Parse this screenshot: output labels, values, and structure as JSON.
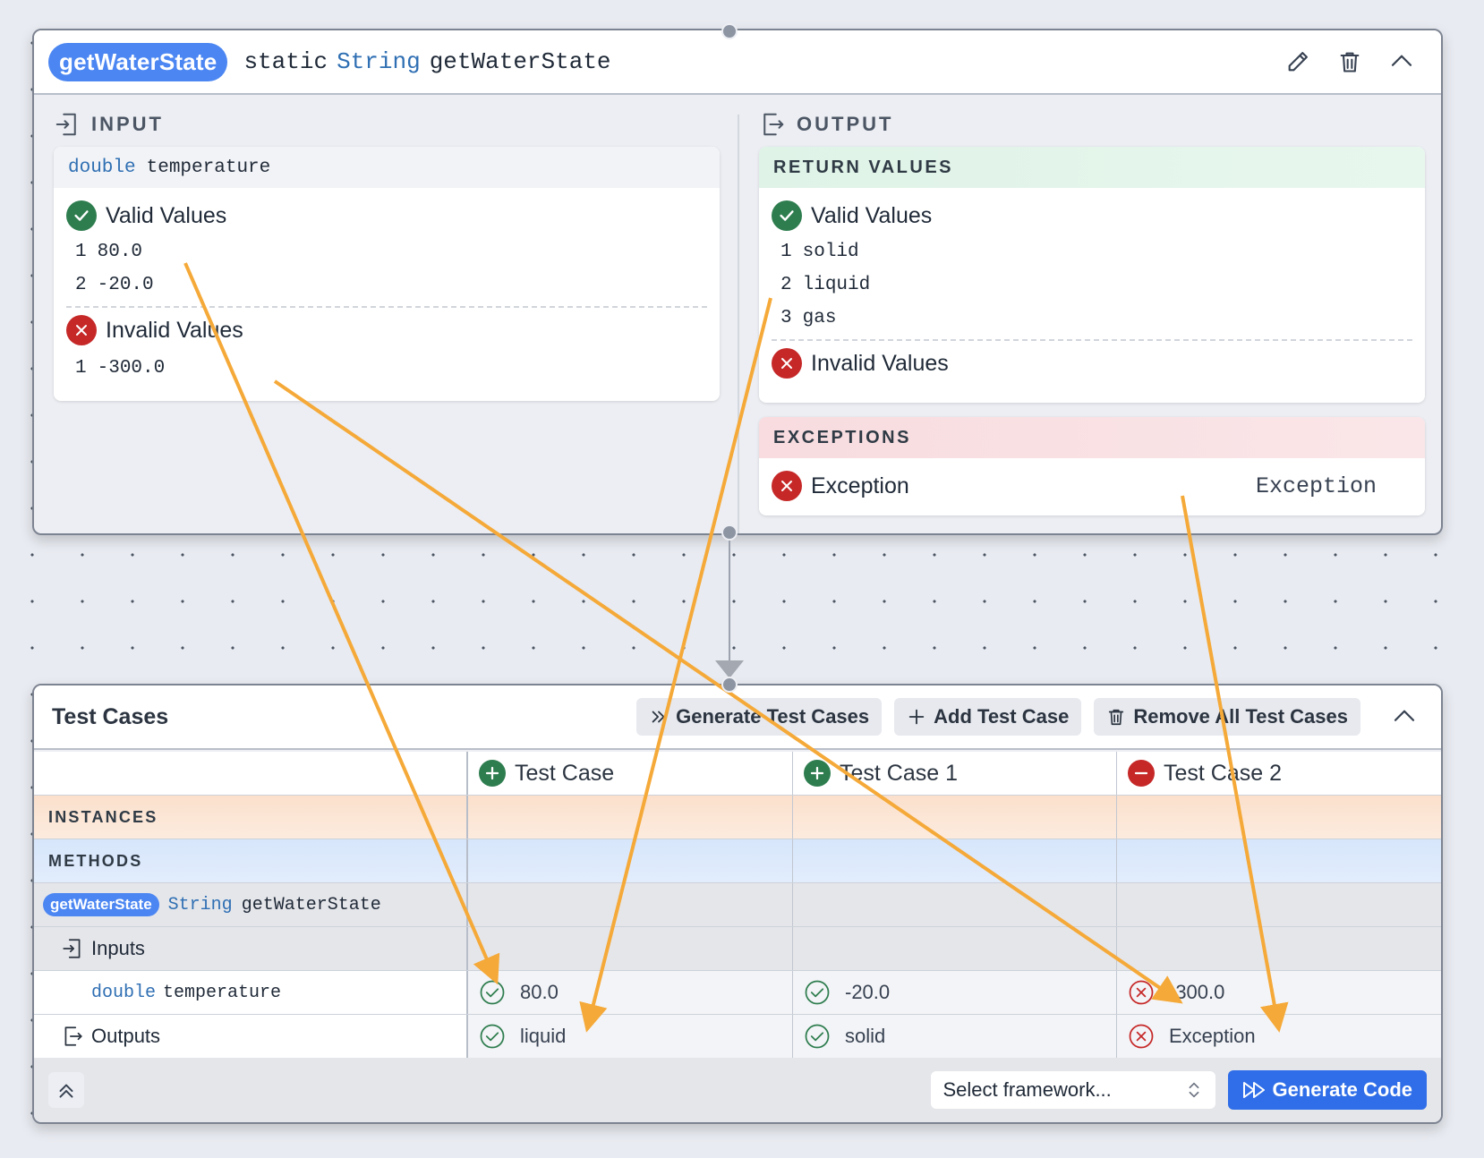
{
  "method": {
    "name_pill": "getWaterState",
    "sig_modifier": "static",
    "sig_type": "String",
    "sig_name": "getWaterState",
    "input_label": "INPUT",
    "output_label": "OUTPUT",
    "input_param_type": "double",
    "input_param_name": "temperature",
    "valid_title": "Valid Values",
    "invalid_title": "Invalid Values",
    "input_valid": [
      {
        "n": "1",
        "v": "80.0"
      },
      {
        "n": "2",
        "v": "-20.0"
      }
    ],
    "input_invalid": [
      {
        "n": "1",
        "v": "-300.0"
      }
    ],
    "return_values_label": "RETURN VALUES",
    "output_valid": [
      {
        "n": "1",
        "v": "solid"
      },
      {
        "n": "2",
        "v": "liquid"
      },
      {
        "n": "3",
        "v": "gas"
      }
    ],
    "exceptions_label": "EXCEPTIONS",
    "exception_title": "Exception",
    "exception_value": "Exception"
  },
  "tests": {
    "title": "Test Cases",
    "generate_label": "Generate Test Cases",
    "add_label": "Add Test Case",
    "remove_label": "Remove All Test Cases",
    "columns": [
      "Test Case",
      "Test Case 1",
      "Test Case 2"
    ],
    "instances_label": "INSTANCES",
    "methods_label": "METHODS",
    "method_pill": "getWaterState",
    "method_type": "String",
    "method_name": "getWaterState",
    "inputs_label": "Inputs",
    "param_type": "double",
    "param_name": "temperature",
    "outputs_label": "Outputs",
    "input_values": [
      "80.0",
      "-20.0",
      "-300.0"
    ],
    "output_values": [
      "liquid",
      "solid",
      "Exception"
    ],
    "framework_placeholder": "Select framework...",
    "generate_code_label": "Generate Code"
  },
  "colors": {
    "accent": "#2f6ee8",
    "pill": "#4b86f2",
    "valid": "#2e7d4f",
    "invalid": "#c62828",
    "arrow": "#f5a938"
  }
}
